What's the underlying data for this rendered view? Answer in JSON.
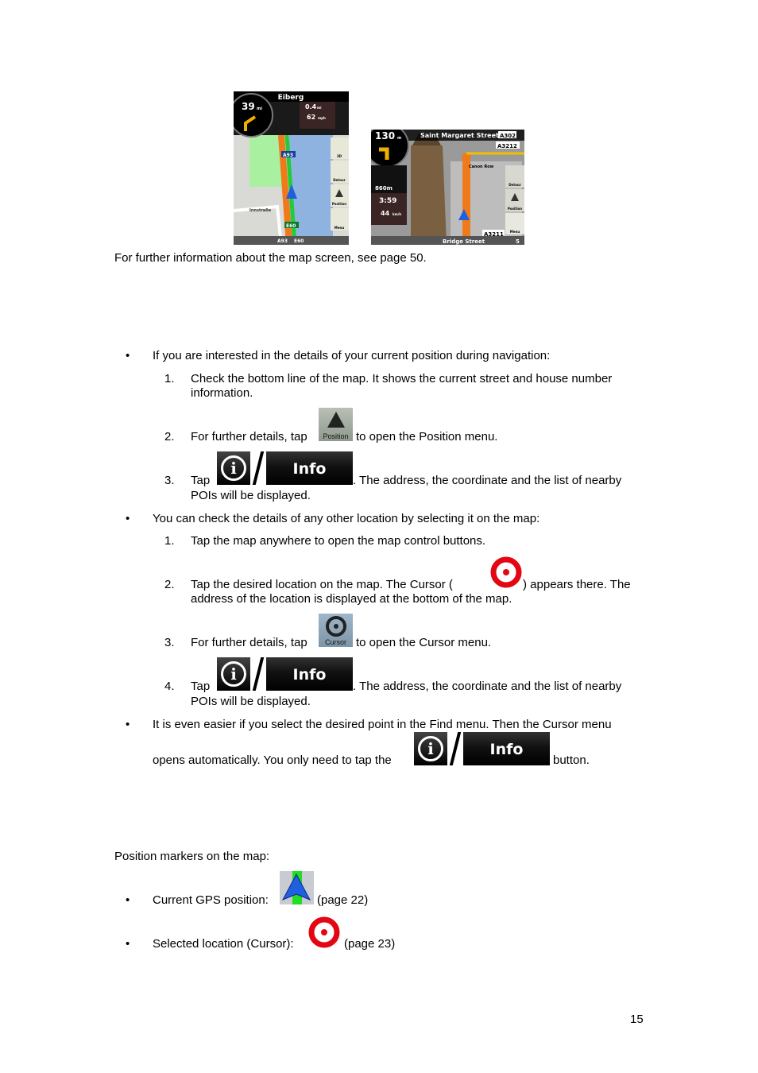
{
  "map1": {
    "street": "Eiberg",
    "dist": "39",
    "dist_unit": "mi",
    "next_dist": "0.4",
    "next_unit": "mi",
    "speed": "62",
    "speed_unit": "mph",
    "road1": "A93",
    "road2": "E60",
    "street_label": "Innstraße",
    "btn_3d": "3D",
    "btn_detour": "Detour",
    "btn_position": "Position",
    "btn_menu": "Menu"
  },
  "map2": {
    "dist": "130",
    "dist_unit": "m",
    "street": "Saint Margaret Street",
    "road1": "A302",
    "road2": "A3212",
    "poi": "Canon Row",
    "next_dist": "860m",
    "time": "3:59",
    "speed": "44",
    "speed_unit": "km/h",
    "btn_detour": "Detour",
    "btn_position": "Position",
    "btn_menu": "Menu",
    "road3": "A3211",
    "bottom_street": "Bridge Street",
    "house": "5"
  },
  "caption": "For further information about the map screen, see page 50.",
  "bullets": {
    "b1": "If you are interested in the details of your current position during navigation:",
    "b1_1_num": "1.",
    "b1_1a": "Check the bottom line of the map. It shows the current street and house number",
    "b1_1b": "information.",
    "b1_2_num": "2.",
    "b1_2a": "For further details, tap",
    "b1_2b": "to open the Position menu.",
    "b1_3_num": "3.",
    "b1_3a": "Tap",
    "b1_3b": ". The address, the coordinate and the list of nearby",
    "b1_3c": "POIs will be displayed.",
    "b2": "You can check the details of any other location by selecting it on the map:",
    "b2_1_num": "1.",
    "b2_1": "Tap the map anywhere to open the map control buttons.",
    "b2_2_num": "2.",
    "b2_2a": "Tap the desired location on the map. The Cursor (",
    "b2_2b": ") appears there. The",
    "b2_2c": "address of the location is displayed at the bottom of the map.",
    "b2_3_num": "3.",
    "b2_3a": "For further details, tap",
    "b2_3b": "to open the Cursor menu.",
    "b2_4_num": "4.",
    "b2_4a": "Tap",
    "b2_4b": ". The address, the coordinate and the list of nearby",
    "b2_4c": "POIs will be displayed.",
    "b3a": "It is even easier if you select the desired point in the Find menu. Then the Cursor menu",
    "b3b": "opens automatically. You only need to tap the",
    "b3c": "button."
  },
  "buttons": {
    "position": "Position",
    "cursor": "Cursor",
    "info": "Info",
    "info_icon": "i"
  },
  "markers": {
    "title": "Position markers on the map:",
    "gps": "Current GPS position:",
    "gps_page": "(page 22)",
    "cursor": "Selected location (Cursor):",
    "cursor_page": "(page 23)"
  },
  "bullet_char": "•",
  "page_number": "15",
  "colors": {
    "cursor_red": "#e30613",
    "route_orange": "#f07a1a",
    "gps_blue": "#1f5fe0"
  }
}
